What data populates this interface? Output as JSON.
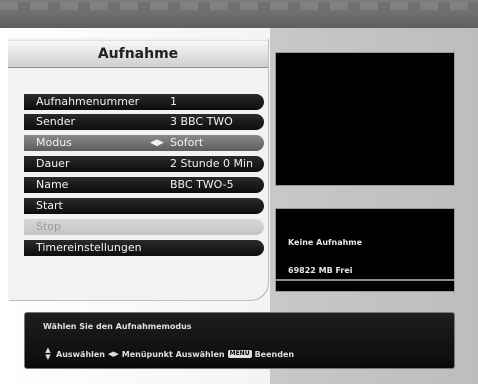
{
  "title": "Aufnahme",
  "menu": [
    {
      "label": "Aufnahmenummer",
      "value": "1"
    },
    {
      "label": "Sender",
      "value": "3 BBC TWO"
    },
    {
      "label": "Modus",
      "value": "Sofort",
      "arrows": "◀▶"
    },
    {
      "label": "Dauer",
      "value": "2 Stunde 0 Min"
    },
    {
      "label": "Name",
      "value": "BBC TWO-5"
    },
    {
      "label": "Start"
    },
    {
      "label": "Stop"
    },
    {
      "label": "Timereinstellungen"
    }
  ],
  "info": {
    "status": "Keine Aufnahme",
    "free_space": "69822 MB Frei"
  },
  "footer": {
    "message": "Wählen Sie den Aufnahmemodus",
    "select_label": "Auswählen",
    "menu_item_select_label": "Menüpunkt Auswählen",
    "menu_key_label": "MENU",
    "exit_label": "Beenden"
  },
  "colors": {
    "item_bg": "#111111",
    "selected_bg": "#7a7a7a",
    "disabled_bg": "#cfcfcf",
    "preview_bg": "#000000"
  }
}
